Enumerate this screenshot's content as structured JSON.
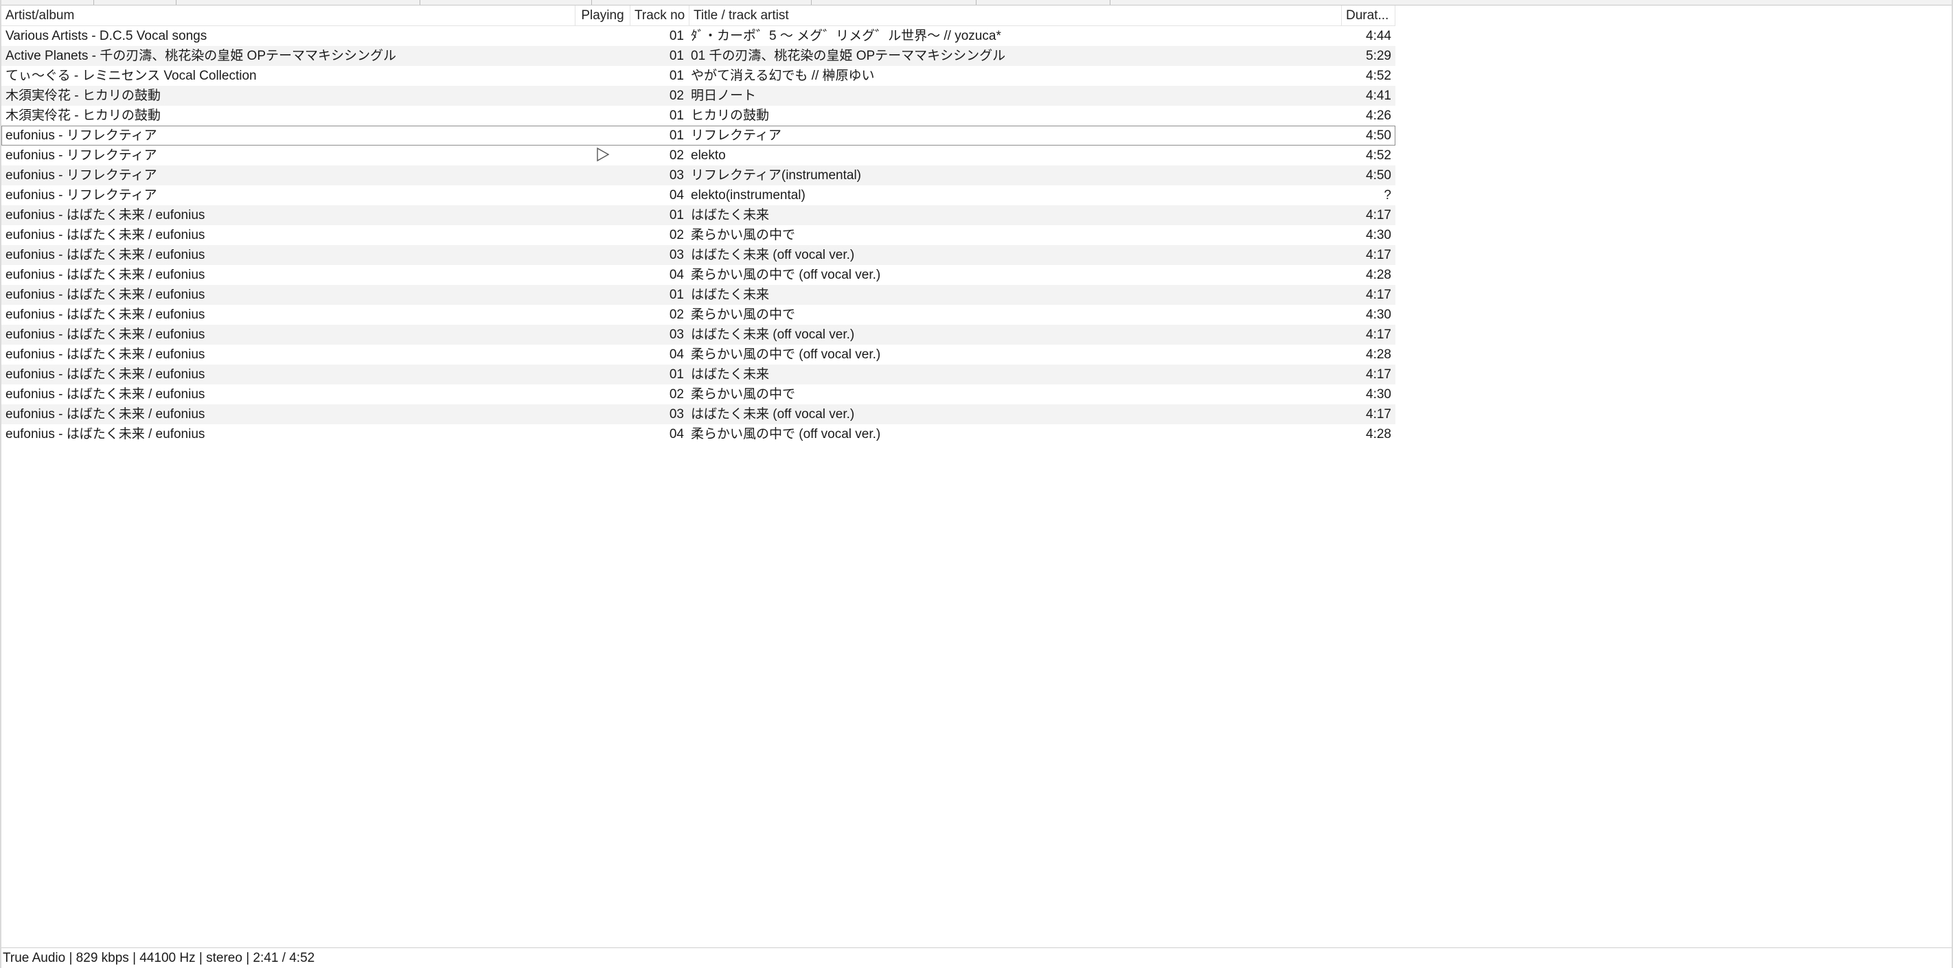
{
  "columns": {
    "artist": "Artist/album",
    "playing": "Playing",
    "track": "Track no",
    "title": "Title / track artist",
    "duration": "Durat..."
  },
  "rows": [
    {
      "artist": "Various Artists - D.C.5 Vocal songs",
      "playing": "",
      "track": "01",
      "title": "ﾀﾞ・カーポ゛5 ～ メグ゛リメグ゛ル世界～ // yozuca*",
      "duration": "4:44"
    },
    {
      "artist": "Active Planets - 千の刃濤、桃花染の皇姫 OPテーママキシシングル",
      "playing": "",
      "track": "01",
      "title": "01 千の刃濤、桃花染の皇姫 OPテーママキシシングル",
      "duration": "5:29"
    },
    {
      "artist": "てぃ～ぐる - レミニセンス Vocal Collection",
      "playing": "",
      "track": "01",
      "title": "やがて消える幻でも // 榊原ゆい",
      "duration": "4:52"
    },
    {
      "artist": "木須実伶花 - ヒカリの鼓動",
      "playing": "",
      "track": "02",
      "title": "明日ノート",
      "duration": "4:41"
    },
    {
      "artist": "木須実伶花 - ヒカリの鼓動",
      "playing": "",
      "track": "01",
      "title": "ヒカリの鼓動",
      "duration": "4:26"
    },
    {
      "artist": "eufonius - リフレクティア",
      "playing": "",
      "track": "01",
      "title": "リフレクティア",
      "duration": "4:50"
    },
    {
      "artist": "eufonius - リフレクティア",
      "playing": "▷",
      "track": "02",
      "title": "elekto",
      "duration": "4:52"
    },
    {
      "artist": "eufonius - リフレクティア",
      "playing": "",
      "track": "03",
      "title": "リフレクティア(instrumental)",
      "duration": "4:50"
    },
    {
      "artist": "eufonius - リフレクティア",
      "playing": "",
      "track": "04",
      "title": "elekto(instrumental)",
      "duration": "?"
    },
    {
      "artist": "eufonius - はばたく未来 / eufonius",
      "playing": "",
      "track": "01",
      "title": "はばたく未来",
      "duration": "4:17"
    },
    {
      "artist": "eufonius - はばたく未来 / eufonius",
      "playing": "",
      "track": "02",
      "title": "柔らかい風の中で",
      "duration": "4:30"
    },
    {
      "artist": "eufonius - はばたく未来 / eufonius",
      "playing": "",
      "track": "03",
      "title": "はばたく未来 (off vocal ver.)",
      "duration": "4:17"
    },
    {
      "artist": "eufonius - はばたく未来 / eufonius",
      "playing": "",
      "track": "04",
      "title": "柔らかい風の中で (off vocal ver.)",
      "duration": "4:28"
    },
    {
      "artist": "eufonius - はばたく未来 / eufonius",
      "playing": "",
      "track": "01",
      "title": "はばたく未来",
      "duration": "4:17"
    },
    {
      "artist": "eufonius - はばたく未来 / eufonius",
      "playing": "",
      "track": "02",
      "title": "柔らかい風の中で",
      "duration": "4:30"
    },
    {
      "artist": "eufonius - はばたく未来 / eufonius",
      "playing": "",
      "track": "03",
      "title": "はばたく未来 (off vocal ver.)",
      "duration": "4:17"
    },
    {
      "artist": "eufonius - はばたく未来 / eufonius",
      "playing": "",
      "track": "04",
      "title": "柔らかい風の中で (off vocal ver.)",
      "duration": "4:28"
    },
    {
      "artist": "eufonius - はばたく未来 / eufonius",
      "playing": "",
      "track": "01",
      "title": "はばたく未来",
      "duration": "4:17"
    },
    {
      "artist": "eufonius - はばたく未来 / eufonius",
      "playing": "",
      "track": "02",
      "title": "柔らかい風の中で",
      "duration": "4:30"
    },
    {
      "artist": "eufonius - はばたく未来 / eufonius",
      "playing": "",
      "track": "03",
      "title": "はばたく未来 (off vocal ver.)",
      "duration": "4:17"
    },
    {
      "artist": "eufonius - はばたく未来 / eufonius",
      "playing": "",
      "track": "04",
      "title": "柔らかい風の中で (off vocal ver.)",
      "duration": "4:28"
    }
  ],
  "state": {
    "focused_row": 5,
    "playing_row": 6
  },
  "statusbar": {
    "text": "True Audio | 829 kbps | 44100 Hz | stereo | 2:41 / 4:52"
  },
  "colors": {
    "row_alt": "#f3f3f3",
    "focus_border": "#8e8e8e",
    "play_icon": "#555555"
  }
}
